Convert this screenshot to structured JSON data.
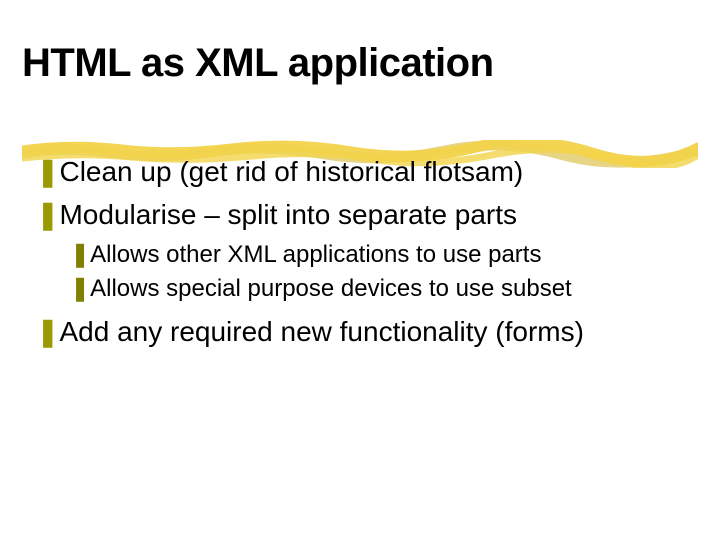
{
  "title": "HTML as XML application",
  "bullets": {
    "glyph_lvl1": "❚",
    "glyph_lvl2": "❚",
    "items": [
      {
        "text": "Clean up (get rid of historical flotsam)"
      },
      {
        "text": "Modularise – split into separate parts",
        "children": [
          {
            "text": "Allows other XML applications to use parts"
          },
          {
            "text": "Allows special purpose devices to use subset"
          }
        ]
      },
      {
        "text": "Add any required new functionality (forms)"
      }
    ]
  },
  "colors": {
    "bullet_lvl1": "#9a9a00",
    "bullet_lvl2": "#808000",
    "underline_main": "#f2d34a",
    "underline_shadow": "#d4b020"
  }
}
